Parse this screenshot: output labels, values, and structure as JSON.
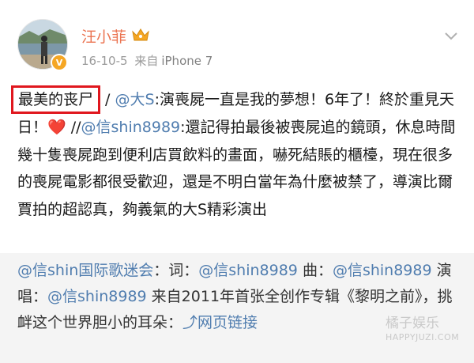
{
  "post": {
    "username": "汪小菲",
    "date": "16-10-5",
    "source_prefix": "来自",
    "device": "iPhone 7",
    "verified_badge": "V",
    "highlight_text": "最美的丧尸",
    "body_segments": [
      {
        "t": " / ",
        "type": "text"
      },
      {
        "t": "@大S",
        "type": "mention"
      },
      {
        "t": ":演喪屍一直是我的夢想！6年了！終於重見天日！",
        "type": "text"
      },
      {
        "t": "❤️",
        "type": "heart"
      },
      {
        "t": " //",
        "type": "text"
      },
      {
        "t": "@信shin8989",
        "type": "mention"
      },
      {
        "t": ":還記得拍最後被喪屍追的鏡頭，休息時間幾十隻喪屍跑到便利店買飲料的畫面，嚇死結賬的櫃檯，現在很多的喪屍電影都很受歡迎，還是不明白當年為什麼被禁了，導演比爾賈拍的超認真，夠義氣的大S精彩演出",
        "type": "text"
      }
    ],
    "icons": {
      "avatar": "avatar-photo",
      "crown": "crown-icon",
      "menu": "chevron-down-icon",
      "heart": "heart-icon"
    }
  },
  "repost": {
    "segments": [
      {
        "t": "@信shin国际歌迷会",
        "type": "mention"
      },
      {
        "t": "：词：",
        "type": "text"
      },
      {
        "t": "@信shin8989",
        "type": "mention"
      },
      {
        "t": " 曲：",
        "type": "text"
      },
      {
        "t": "@信shin8989",
        "type": "mention"
      },
      {
        "t": " 演唱：",
        "type": "text"
      },
      {
        "t": "@信shin8989",
        "type": "mention"
      },
      {
        "t": " 来自2011年首张全创作专辑《黎明之前》，挑衅这个世界胆小的耳朵：",
        "type": "text"
      },
      {
        "t": "网页链接",
        "type": "link"
      }
    ]
  },
  "watermark": {
    "line1": "橘子娱乐",
    "line2": "HAPPYJUZI.COM"
  },
  "colors": {
    "username": "#eb7350",
    "mention": "#507daf",
    "highlight_border": "#e0171e",
    "repost_bg": "#f4f4f4"
  }
}
